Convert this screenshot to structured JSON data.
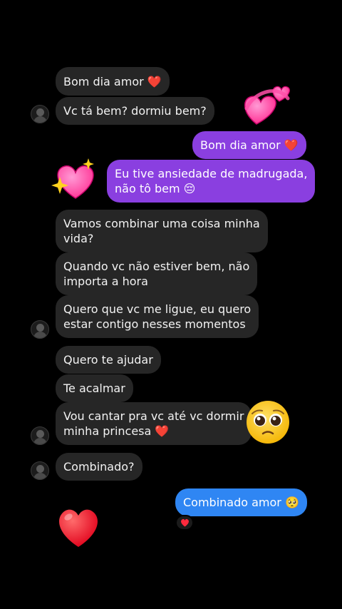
{
  "messages": {
    "m1": "Bom dia amor ❤️",
    "m2": "Vc tá bem? dormiu bem?",
    "m3": "Bom dia amor ❤️",
    "m4": "Eu tive ansiedade de madrugada,\nnão tô bem 😔",
    "m5": "Vamos combinar uma coisa minha\nvida?",
    "m6": "Quando vc não estiver bem, não\nimporta a hora",
    "m7": "Quero que vc me ligue, eu quero\nestar contigo nesses momentos",
    "m8": "Quero te ajudar",
    "m9": "Te acalmar",
    "m10": "Vou cantar pra vc até vc dormir\nminha princesa ❤️",
    "m11": "Combinado?",
    "m12": "Combinado amor 🥺"
  },
  "colors": {
    "incoming_bubble": "#262626",
    "outgoing_purple": "#8a3fe0",
    "outgoing_blue": "#2f86f3",
    "background": "#000000"
  },
  "icons": {
    "avatar": "profile-avatar",
    "sticker_hearts": "two-hearts-sticker",
    "sticker_sparkle_heart": "sparkling-heart-sticker",
    "sticker_pleading": "pleading-face-sticker",
    "sticker_big_heart": "red-heart-sticker",
    "reaction": "red-heart-reaction"
  }
}
